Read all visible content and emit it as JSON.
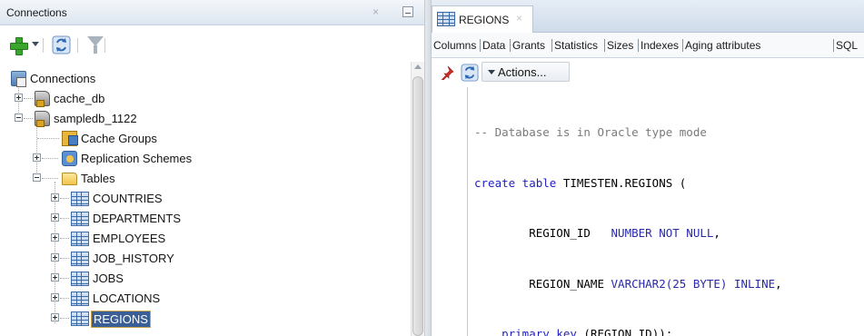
{
  "connections_panel": {
    "title": "Connections",
    "close_glyph": "×",
    "toolbar": {
      "add_icon": "plus-icon",
      "dropdown_icon": "chevron-down-icon",
      "refresh_icon": "refresh-icon",
      "filter_icon": "filter-icon"
    },
    "tree": {
      "root": "Connections",
      "connections": [
        {
          "label": "cache_db",
          "expanded": false
        },
        {
          "label": "sampledb_1122",
          "expanded": true
        }
      ],
      "children": [
        {
          "label": "Cache Groups"
        },
        {
          "label": "Replication Schemes"
        },
        {
          "label": "Tables"
        }
      ],
      "tables": [
        {
          "label": "COUNTRIES"
        },
        {
          "label": "DEPARTMENTS"
        },
        {
          "label": "EMPLOYEES"
        },
        {
          "label": "JOB_HISTORY"
        },
        {
          "label": "JOBS"
        },
        {
          "label": "LOCATIONS"
        },
        {
          "label": "REGIONS",
          "selected": true
        }
      ]
    }
  },
  "editor": {
    "tab": {
      "label": "REGIONS",
      "close_glyph": "×"
    },
    "subtabs": [
      "Columns",
      "Data",
      "Grants",
      "Statistics",
      "Sizes",
      "Indexes",
      "Aging attributes",
      "SQL"
    ],
    "active_subtab": "SQL",
    "toolbar": {
      "pin_icon": "pin-icon",
      "refresh_icon": "refresh-icon",
      "actions_label": "Actions..."
    },
    "sql_lines": [
      "-- Database is in Oracle type mode",
      "create table TIMESTEN.REGIONS (",
      "        REGION_ID   NUMBER NOT NULL,",
      "        REGION_NAME VARCHAR2(25 BYTE) INLINE,",
      "    primary key (REGION_ID));"
    ]
  },
  "colors": {
    "selection": "#3a5f96",
    "keyword": "#1f1fbf",
    "comment": "#7a7a7a",
    "header_gradient_top": "#f3f6fa",
    "header_gradient_bottom": "#dde6f0"
  }
}
